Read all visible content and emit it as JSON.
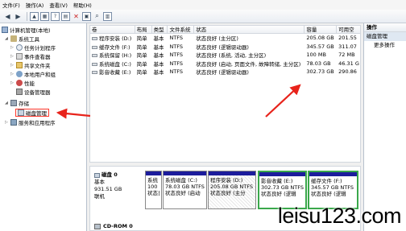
{
  "menu": [
    "文件(F)",
    "操作(A)",
    "查看(V)",
    "帮助(H)"
  ],
  "toolbar": {
    "icons": [
      "back-arrow-icon",
      "forward-arrow-icon",
      "up-folder-icon",
      "properties-icon",
      "help-icon",
      "disk-icon",
      "delete-icon",
      "properties2-icon",
      "search-icon",
      "doc-icon"
    ]
  },
  "tree": {
    "root": "计算机管理(本地)",
    "system_tools": "系统工具",
    "task_scheduler": "任务计划程序",
    "event_viewer": "事件查看器",
    "shared_folders": "共享文件夹",
    "local_users": "本地用户和组",
    "performance": "性能",
    "device_manager": "设备管理器",
    "storage": "存储",
    "disk_management": "磁盘管理",
    "services": "服务和应用程序"
  },
  "volumes": {
    "columns": [
      "卷",
      "布局",
      "类型",
      "文件系统",
      "状态",
      "容量",
      "可用空"
    ],
    "rows": [
      {
        "vol": "程序安装 (D:)",
        "layout": "简单",
        "type": "基本",
        "fs": "NTFS",
        "status": "状态良好 (主分区)",
        "capacity": "205.08 GB",
        "free": "201.55"
      },
      {
        "vol": "缓存文件 (F:)",
        "layout": "简单",
        "type": "基本",
        "fs": "NTFS",
        "status": "状态良好 (逻辑驱动器)",
        "capacity": "345.57 GB",
        "free": "311.07"
      },
      {
        "vol": "系统保留 (H:)",
        "layout": "简单",
        "type": "基本",
        "fs": "NTFS",
        "status": "状态良好 (系统, 活动, 主分区)",
        "capacity": "100 MB",
        "free": "72 MB"
      },
      {
        "vol": "系统磁盘 (C:)",
        "layout": "简单",
        "type": "基本",
        "fs": "NTFS",
        "status": "状态良好 (启动, 页面文件, 故障转储, 主分区)",
        "capacity": "78.03 GB",
        "free": "46.31 G"
      },
      {
        "vol": "影音收藏 (E:)",
        "layout": "简单",
        "type": "基本",
        "fs": "NTFS",
        "status": "状态良好 (逻辑驱动器)",
        "capacity": "302.73 GB",
        "free": "290.86"
      }
    ]
  },
  "actions": {
    "title": "操作",
    "section": "磁盘管理",
    "more": "更多操作"
  },
  "disk0": {
    "name": "磁盘 0",
    "type": "基本",
    "size": "931.51 GB",
    "status": "联机",
    "partitions": [
      {
        "line1": "系统",
        "line2": "100 MB",
        "line3": "状态良"
      },
      {
        "line1": "系统磁盘 (C:)",
        "line2": "78.03 GB NTFS",
        "line3": "状态良好 (启动"
      },
      {
        "line1": "程序安装 (D:)",
        "line2": "205.08 GB NTFS",
        "line3": "状态良好 (主分"
      },
      {
        "line1": "影音收藏 (E:)",
        "line2": "302.73 GB NTFS",
        "line3": "状态良好 (逻辑"
      },
      {
        "line1": "缓存文件 (F:)",
        "line2": "345.57 GB NTFS",
        "line3": "状态良好 (逻辑"
      }
    ]
  },
  "cdrom": "CD-ROM 0",
  "watermark": "leisu123.com",
  "colors": {
    "arrow": "#e8231b",
    "partition_bar": "#1c1c9c",
    "extended": "#3aa84b"
  }
}
